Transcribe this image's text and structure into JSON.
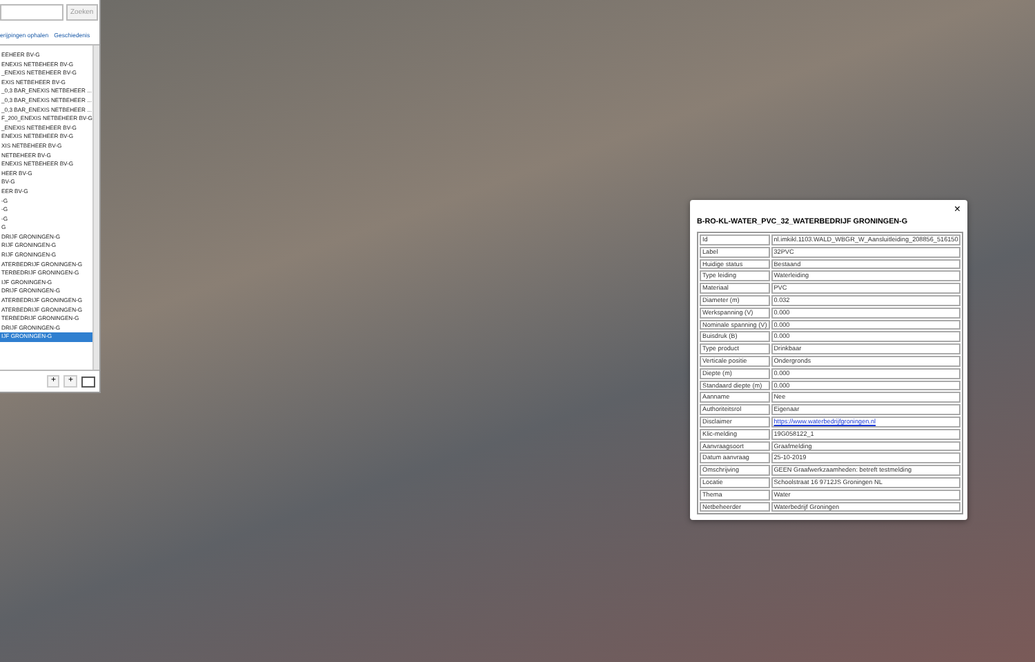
{
  "search": {
    "button": "Zoeken"
  },
  "links": [
    "erijpingen ophalen",
    "Geschiedenis"
  ],
  "layers": [
    {
      "label": "EEHEER BV-G",
      "selected": false
    },
    {
      "label": "ENEXIS NETBEHEER BV-G",
      "selected": false
    },
    {
      "label": "_ENEXIS NETBEHEER BV-G",
      "selected": false
    },
    {
      "label": "EXIS NETBEHEER BV-G",
      "selected": false
    },
    {
      "label": "_0,3 BAR_ENEXIS NETBEHEER ...",
      "selected": false
    },
    {
      "label": "_0,3 BAR_ENEXIS NETBEHEER ...",
      "selected": false
    },
    {
      "label": "_0,3 BAR_ENEXIS NETBEHEER ...",
      "selected": false
    },
    {
      "label": "F_200_ENEXIS NETBEHEER BV-G",
      "selected": false
    },
    {
      "label": "_ENEXIS NETBEHEER BV-G",
      "selected": false
    },
    {
      "label": "ENEXIS NETBEHEER BV-G",
      "selected": false
    },
    {
      "label": "XIS NETBEHEER BV-G",
      "selected": false
    },
    {
      "label": "NETBEHEER BV-G",
      "selected": false
    },
    {
      "label": "ENEXIS NETBEHEER BV-G",
      "selected": false
    },
    {
      "label": "HEER BV-G",
      "selected": false
    },
    {
      "label": "BV-G",
      "selected": false
    },
    {
      "label": "EER BV-G",
      "selected": false
    },
    {
      "label": "-G",
      "selected": false
    },
    {
      "label": "-G",
      "selected": false
    },
    {
      "label": "-G",
      "selected": false
    },
    {
      "label": "G",
      "selected": false
    },
    {
      "label": "DRIJF GRONINGEN-G",
      "selected": false
    },
    {
      "label": "RIJF GRONINGEN-G",
      "selected": false
    },
    {
      "label": "RIJF GRONINGEN-G",
      "selected": false
    },
    {
      "label": "ATERBEDRIJF GRONINGEN-G",
      "selected": false
    },
    {
      "label": "TERBEDRIJF GRONINGEN-G",
      "selected": false
    },
    {
      "label": "IJF GRONINGEN-G",
      "selected": false
    },
    {
      "label": "DRIJF GRONINGEN-G",
      "selected": false
    },
    {
      "label": "ATERBEDRIJF GRONINGEN-G",
      "selected": false
    },
    {
      "label": "ATERBEDRIJF GRONINGEN-G",
      "selected": false
    },
    {
      "label": "TERBEDRIJF GRONINGEN-G",
      "selected": false
    },
    {
      "label": "DRIJF GRONINGEN-G",
      "selected": false
    },
    {
      "label": "IJF GRONINGEN-G",
      "selected": true
    }
  ],
  "list_buttons": [
    "+",
    "+"
  ],
  "popup": {
    "title": "B-RO-KL-WATER_PVC_32_WATERBEDRIJF GRONINGEN-G",
    "close": "×",
    "rows": [
      {
        "key": "Id",
        "value": "nl.imkikl.1103.WALD_WBGR_W_Aansluitleiding_208856_516150",
        "kind": "text"
      },
      {
        "key": "Label",
        "value": "32PVC",
        "kind": "text"
      },
      {
        "key": "Huidige status",
        "value": "Bestaand",
        "kind": "text"
      },
      {
        "key": "Type leiding",
        "value": "Waterleiding",
        "kind": "text"
      },
      {
        "key": "Materiaal",
        "value": "PVC",
        "kind": "text"
      },
      {
        "key": "Diameter (m)",
        "value": "0.032",
        "kind": "text"
      },
      {
        "key": "Werkspanning (V)",
        "value": "0.000",
        "kind": "text"
      },
      {
        "key": "Nominale spanning (V)",
        "value": "0.000",
        "kind": "text"
      },
      {
        "key": "Buisdruk (B)",
        "value": "0.000",
        "kind": "text"
      },
      {
        "key": "Type product",
        "value": "Drinkbaar",
        "kind": "text"
      },
      {
        "key": "Verticale positie",
        "value": "Ondergronds",
        "kind": "text"
      },
      {
        "key": "Diepte (m)",
        "value": "0.000",
        "kind": "text"
      },
      {
        "key": "Standaard diepte (m)",
        "value": "0.000",
        "kind": "text"
      },
      {
        "key": "Aanname",
        "value": "Nee",
        "kind": "text"
      },
      {
        "key": "Authoriteitsrol",
        "value": "Eigenaar",
        "kind": "text"
      },
      {
        "key": "Disclaimer",
        "value": "https://www.waterbedrijfgroningen.nl",
        "kind": "link"
      },
      {
        "key": "Klic-melding",
        "value": "19G058122_1",
        "kind": "text"
      },
      {
        "key": "Aanvraagsoort",
        "value": "Graafmelding",
        "kind": "text"
      },
      {
        "key": "Datum aanvraag",
        "value": "25-10-2019",
        "kind": "text"
      },
      {
        "key": "Omschrijving",
        "value": "GEEN Graafwerkzaamheden: betreft testmelding",
        "kind": "text"
      },
      {
        "key": "Locatie",
        "value": "Schoolstraat 16 9712JS Groningen NL",
        "kind": "text"
      },
      {
        "key": "Thema",
        "value": "Water",
        "kind": "text"
      },
      {
        "key": "Netbeheerder",
        "value": "Waterbedrijf Groningen",
        "kind": "text"
      }
    ]
  }
}
